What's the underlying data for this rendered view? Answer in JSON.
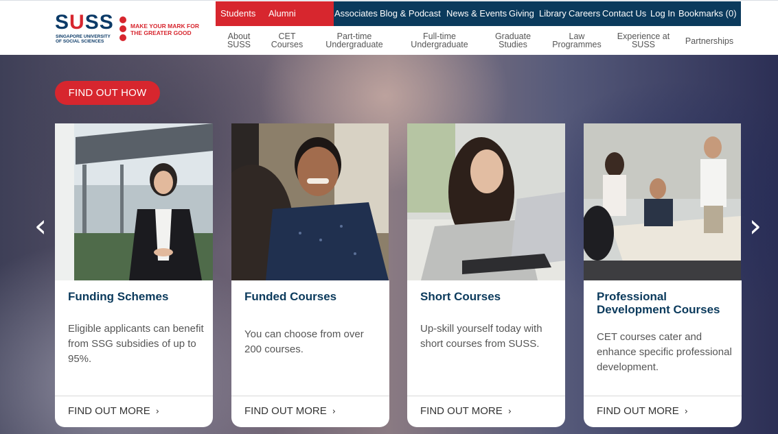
{
  "brand": {
    "name_left": "S",
    "name_u": "U",
    "name_right": "SS",
    "subtitle": "SINGAPORE UNIVERSITY OF SOCIAL SCIENCES",
    "tagline": "MAKE YOUR MARK FOR THE GREATER GOOD"
  },
  "utility_nav": {
    "highlighted": [
      "Students",
      "Alumni"
    ],
    "links": [
      "Associates",
      "Blog & Podcast",
      "News & Events",
      "Giving",
      "Library",
      "Careers",
      "Contact Us",
      "Log In",
      "Bookmarks (0)"
    ]
  },
  "main_nav": [
    {
      "line1": "About",
      "line2": "SUSS"
    },
    {
      "line1": "CET",
      "line2": "Courses"
    },
    {
      "line1": "Part-time",
      "line2": "Undergraduate"
    },
    {
      "line1": "Full-time",
      "line2": "Undergraduate"
    },
    {
      "line1": "Graduate",
      "line2": "Studies"
    },
    {
      "line1": "Law",
      "line2": "Programmes"
    },
    {
      "line1": "Experience at",
      "line2": "SUSS"
    },
    {
      "line1": "Partnerships",
      "line2": ""
    }
  ],
  "hero": {
    "cta": "FIND OUT HOW",
    "prev_arrow": "‹",
    "next_arrow": "›"
  },
  "cards": [
    {
      "title": "Funding Schemes",
      "desc": "Eligible applicants can benefit from SSG subsidies of up to 95%.",
      "cta": "FIND OUT MORE"
    },
    {
      "title": "Funded Courses",
      "desc": "You can choose from over 200 courses.",
      "cta": "FIND OUT MORE"
    },
    {
      "title": "Short Courses",
      "desc": "Up-skill yourself today with short courses from SUSS.",
      "cta": "FIND OUT MORE"
    },
    {
      "title": "Professional Development Courses",
      "desc": "CET courses cater and enhance specific professional development.",
      "cta": "FIND OUT MORE"
    }
  ],
  "colors": {
    "brand_red": "#d7262e",
    "brand_navy": "#0b3a5c"
  }
}
